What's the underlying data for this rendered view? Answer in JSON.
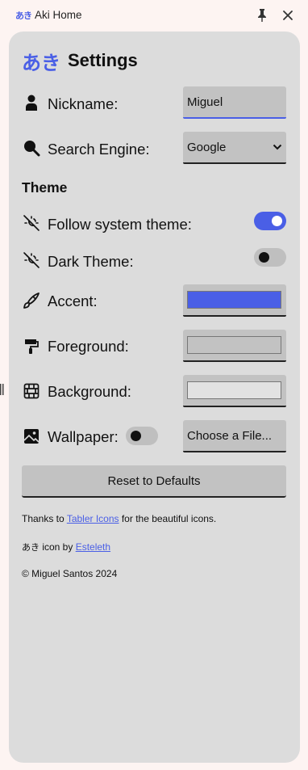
{
  "window": {
    "logo_text": "あき",
    "title": "Aki Home",
    "pin_icon": "pin-icon",
    "close_icon": "close-icon"
  },
  "header": {
    "kana": "あき",
    "title": "Settings"
  },
  "nickname": {
    "label": "Nickname:",
    "value": "Miguel",
    "icon": "user-icon"
  },
  "search_engine": {
    "label": "Search Engine:",
    "selected": "Google",
    "icon": "search-icon"
  },
  "theme": {
    "section_title": "Theme",
    "follow_system": {
      "label": "Follow system theme:",
      "enabled": true,
      "icon": "sun-moon-icon"
    },
    "dark_theme": {
      "label": "Dark Theme:",
      "enabled": false,
      "icon": "sun-moon-icon"
    },
    "accent": {
      "label": "Accent:",
      "color": "#4a5fe6",
      "icon": "brush-icon"
    },
    "foreground": {
      "label": "Foreground:",
      "color": "#c2c2c2",
      "icon": "paint-roller-icon"
    },
    "background": {
      "label": "Background:",
      "color": "#e2e2e2",
      "icon": "wall-icon"
    },
    "wallpaper": {
      "label": "Wallpaper:",
      "enabled": false,
      "button_label": "Choose a File...",
      "icon": "photo-icon"
    }
  },
  "reset_button": "Reset to Defaults",
  "footer": {
    "thanks_prefix": "Thanks to ",
    "thanks_link": "Tabler Icons",
    "thanks_suffix": " for the beautiful icons.",
    "icon_prefix_kana": "あき",
    "icon_prefix": " icon by ",
    "icon_link": "Esteleth",
    "copyright": "© Miguel Santos 2024"
  }
}
